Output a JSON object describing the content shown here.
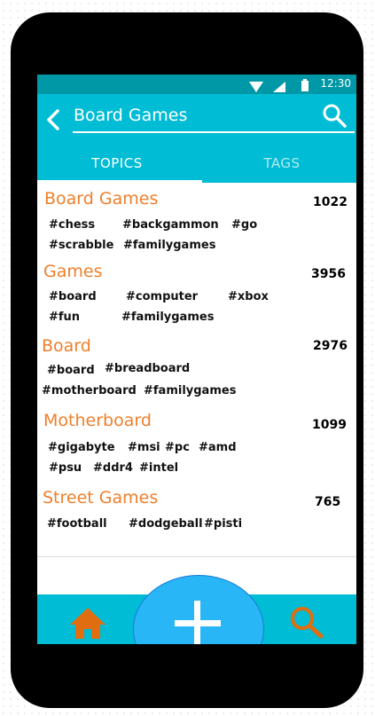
{
  "status_bar": {
    "time": "12:30"
  },
  "app_bar": {
    "search_value": "Board Games"
  },
  "tabs": [
    {
      "label": "TOPICS",
      "active": true
    },
    {
      "label": "TAGS",
      "active": false
    }
  ],
  "topics": [
    {
      "title": "Board Games",
      "count": "1022",
      "tags": [
        "#chess",
        "#backgammon",
        "#go",
        "#scrabble",
        "#familygames"
      ]
    },
    {
      "title": "Games",
      "count": "3956",
      "tags": [
        "#board",
        "#computer",
        "#xbox",
        "#fun",
        "#familygames"
      ]
    },
    {
      "title": "Board",
      "count": "2976",
      "tags": [
        "#board",
        "#breadboard",
        "#motherboard",
        "#familygames"
      ]
    },
    {
      "title": "Motherboard",
      "count": "1099",
      "tags": [
        "#gigabyte",
        "#msi",
        "#pc",
        "#amd",
        "#psu",
        "#ddr4",
        "#intel"
      ]
    },
    {
      "title": "Street Games",
      "count": "765",
      "tags": [
        "#football",
        "#dodgeball",
        "#pisti"
      ]
    }
  ],
  "colors": {
    "primary": "#00bcd4",
    "status_bar": "#0097a7",
    "accent_orange": "#f07f2a",
    "fab": "#29b6f6"
  },
  "icons": {
    "back": "chevron-left-icon",
    "search": "search-icon",
    "home": "home-icon",
    "add": "plus-icon",
    "wifi": "wifi-icon",
    "signal": "signal-icon",
    "battery": "battery-icon"
  }
}
